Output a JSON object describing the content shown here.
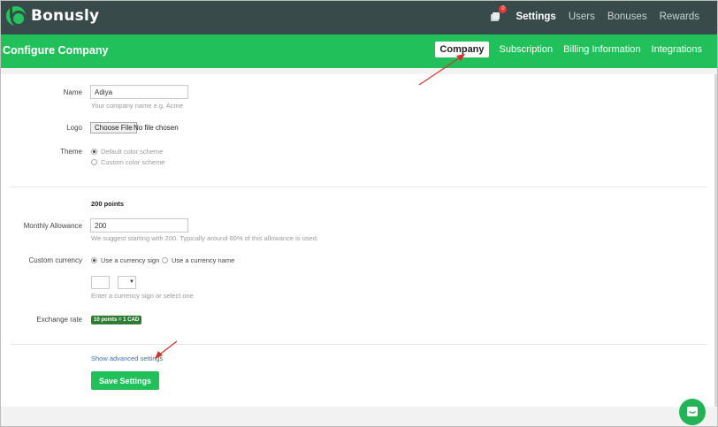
{
  "app": {
    "name": "Bonusly"
  },
  "nav": {
    "notification_count": "0",
    "items": [
      {
        "label": "Settings",
        "active": true
      },
      {
        "label": "Users"
      },
      {
        "label": "Bonuses"
      },
      {
        "label": "Rewards"
      }
    ]
  },
  "header": {
    "title": "Configure Company",
    "tabs": [
      {
        "label": "Company",
        "active": true
      },
      {
        "label": "Subscription"
      },
      {
        "label": "Billing Information"
      },
      {
        "label": "Integrations"
      }
    ]
  },
  "form": {
    "name": {
      "label": "Name",
      "value": "Adiya",
      "hint": "Your company name e.g. Acme"
    },
    "logo": {
      "label": "Logo",
      "button": "Choose File",
      "status": "No file chosen"
    },
    "theme": {
      "label": "Theme",
      "options": [
        "Default color scheme",
        "Custom color scheme"
      ],
      "selected": 0
    },
    "points_heading": "200 points",
    "allowance": {
      "label": "Monthly Allowance",
      "value": "200",
      "hint": "We suggest starting with 200. Typically around 60% of this allowance is used."
    },
    "currency": {
      "label": "Custom currency",
      "options": [
        "Use a currency sign",
        "Use a currency name"
      ],
      "selected": 0,
      "hint": "Enter a currency sign or select one"
    },
    "exchange": {
      "label": "Exchange rate",
      "badge": "10 points = 1 CAD"
    },
    "advanced_link": "Show advanced settings",
    "save": "Save Settings"
  },
  "colors": {
    "nav_bg": "#394a4b",
    "brand_green": "#21c05a",
    "annotation": "#d32f2f"
  }
}
